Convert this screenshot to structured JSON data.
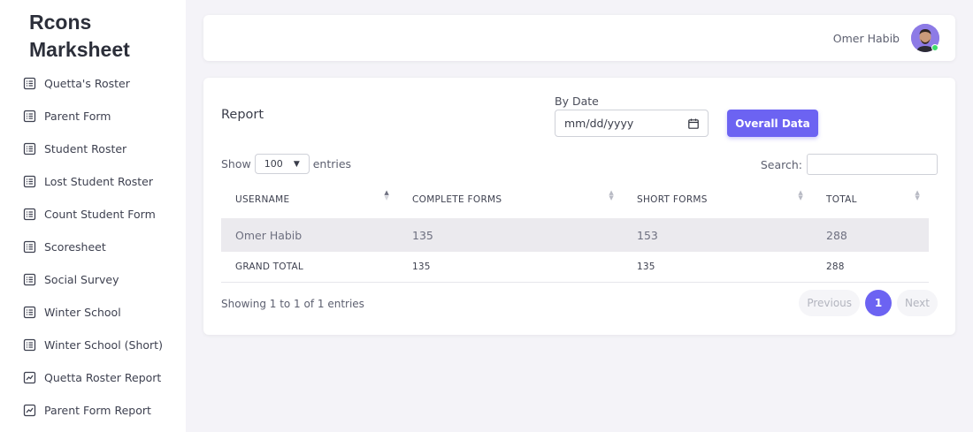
{
  "sidebar": {
    "brand": "Rcons Marksheet",
    "items": [
      {
        "label": "Quetta's Roster",
        "icon": "list-icon"
      },
      {
        "label": "Parent Form",
        "icon": "list-icon"
      },
      {
        "label": "Student Roster",
        "icon": "list-icon"
      },
      {
        "label": "Lost Student Roster",
        "icon": "list-icon"
      },
      {
        "label": "Count Student Form",
        "icon": "list-icon"
      },
      {
        "label": "Scoresheet",
        "icon": "list-icon"
      },
      {
        "label": "Social Survey",
        "icon": "list-icon"
      },
      {
        "label": "Winter School",
        "icon": "list-icon"
      },
      {
        "label": "Winter School (Short)",
        "icon": "list-icon"
      },
      {
        "label": "Quetta Roster Report",
        "icon": "chart-icon"
      },
      {
        "label": "Parent Form Report",
        "icon": "chart-icon"
      }
    ]
  },
  "topbar": {
    "user_name": "Omer Habib"
  },
  "report": {
    "title": "Report",
    "date_label": "By Date",
    "date_placeholder": "mm/dd/yyyy",
    "overall_button": "Overall Data",
    "show_label": "Show",
    "entries_label": "entries",
    "page_size": "100",
    "search_label": "Search:",
    "columns": [
      "USERNAME",
      "COMPLETE FORMS",
      "SHORT FORMS",
      "TOTAL"
    ],
    "rows": [
      [
        "Omer Habib",
        "135",
        "153",
        "288"
      ]
    ],
    "footer": [
      "GRAND TOTAL",
      "135",
      "135",
      "288"
    ],
    "info": "Showing 1 to 1 of 1 entries",
    "pager": {
      "previous": "Previous",
      "current": "1",
      "next": "Next"
    }
  },
  "colors": {
    "accent": "#6c63f2",
    "background": "#f4f3f8",
    "online": "#3ddc6b"
  }
}
